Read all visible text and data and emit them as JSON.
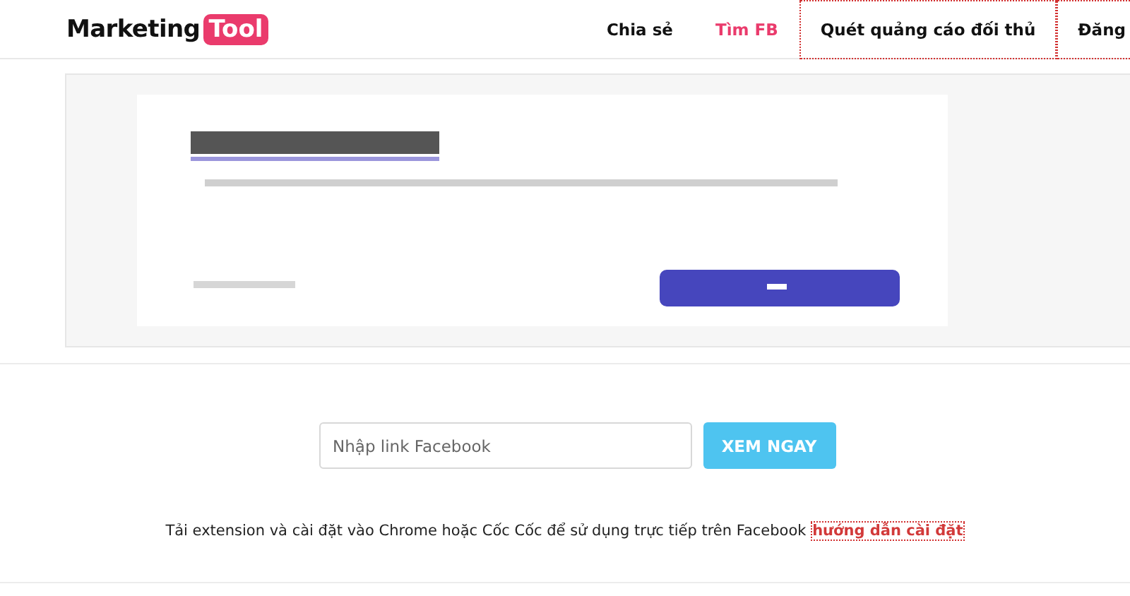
{
  "logo": {
    "text": "Marketing",
    "badge": "Tool"
  },
  "nav": [
    {
      "label": "Chia sẻ",
      "selected": false,
      "focused": false
    },
    {
      "label": "Tìm FB",
      "selected": true,
      "focused": false
    },
    {
      "label": "Quét quảng cáo đối thủ",
      "selected": false,
      "focused": true
    },
    {
      "label": "Đăng",
      "selected": false,
      "focused": true
    }
  ],
  "search": {
    "placeholder": "Nhập link Facebook",
    "button": "XEM NGAY"
  },
  "note": {
    "text": "Tải extension và cài đặt vào Chrome hoặc Cốc Cốc để sử dụng trực tiếp trên Facebook",
    "link": "hướng dẫn cài đặt",
    "link_focused": true
  }
}
